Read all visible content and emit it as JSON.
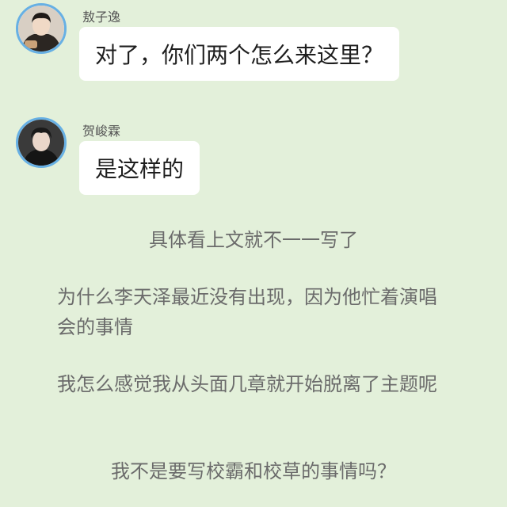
{
  "chat": {
    "messages": [
      {
        "sender": "敖子逸",
        "text": "对了，你们两个怎么来这里？",
        "avatar_icon": "avatar-photo-icon"
      },
      {
        "sender": "贺峻霖",
        "text": "是这样的",
        "avatar_icon": "avatar-photo-icon"
      }
    ]
  },
  "notes": {
    "line1": "具体看上文就不一一写了",
    "para2": "为什么李天泽最近没有出现，因为他忙着演唱会的事情",
    "para3": "我怎么感觉我从头面几章就开始脱离了主题呢",
    "line4": "我不是要写校霸和校草的事情吗？"
  },
  "colors": {
    "background": "#e3f0da",
    "avatar_ring": "#67b0e4",
    "bubble": "#ffffff",
    "note_text": "#6b6b6b"
  }
}
